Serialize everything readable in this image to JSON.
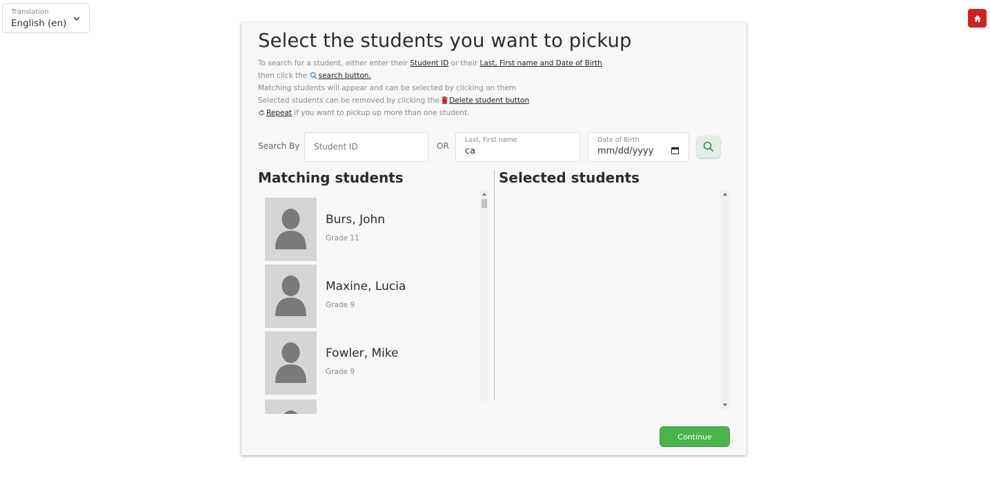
{
  "translation": {
    "label": "Translation",
    "value": "English (en)"
  },
  "colors": {
    "accent_green": "#4cb34c",
    "home_red": "#d32020",
    "link": "#222222"
  },
  "page": {
    "title": "Select the students you want to pickup",
    "instructions": {
      "line1_pre": "To search for a student, either enter their ",
      "line1_link1": "Student ID",
      "line1_mid": " or their ",
      "line1_link2": "Last, First name and Date of Birth",
      "line2_pre": "then click the ",
      "line2_link": "search button.",
      "line3": "Matching students will appear and can be selected by clicking on them",
      "line4_pre": "Selected students can be removed by clicking the ",
      "line4_link": "Delete student button",
      "line4_post": ".",
      "line5_link": "Repeat",
      "line5_post": " if you want to pickup up more than one student."
    }
  },
  "search": {
    "search_by_label": "Search By",
    "student_id_placeholder": "Student ID",
    "or_label": "OR",
    "name_label": "Last, First name",
    "name_value": "ca",
    "dob_label": "Date of Birth",
    "dob_value": "mm/dd/yyyy"
  },
  "matching": {
    "title": "Matching students",
    "students": [
      {
        "name": "Burs, John",
        "grade": "Grade 11"
      },
      {
        "name": "Maxine, Lucia",
        "grade": "Grade 9"
      },
      {
        "name": "Fowler, Mike",
        "grade": "Grade 9"
      }
    ]
  },
  "selected": {
    "title": "Selected students"
  },
  "continue_label": "Continue"
}
